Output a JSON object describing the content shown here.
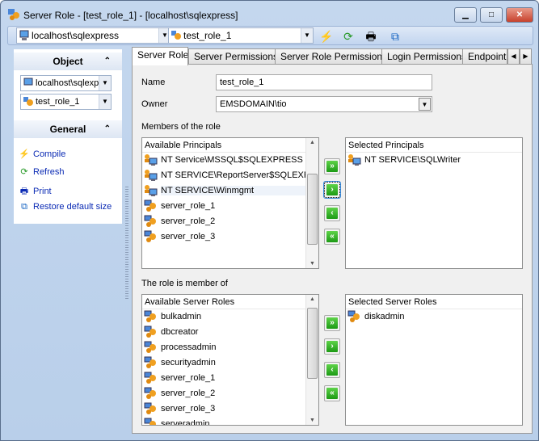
{
  "window": {
    "title": "Server Role - [test_role_1] - [localhost\\sqlexpress]",
    "minimize": "▁",
    "maximize": "□",
    "close": "✕"
  },
  "toolbar": {
    "server": "localhost\\sqlexpress",
    "role": "test_role_1"
  },
  "left_panel": {
    "object_header": "Object",
    "server": "localhost\\sqlexpress",
    "role": "test_role_1",
    "general_header": "General",
    "items": [
      {
        "label": "Compile",
        "icon": "compile-icon"
      },
      {
        "label": "Refresh",
        "icon": "refresh-icon"
      },
      {
        "label": "Print",
        "icon": "print-icon"
      },
      {
        "label": "Restore default size",
        "icon": "restore-size-icon"
      }
    ]
  },
  "tabs": [
    "Server Role",
    "Server Permissions",
    "Server Role Permissions",
    "Login Permissions",
    "Endpoint P"
  ],
  "form": {
    "name_label": "Name",
    "name_value": "test_role_1",
    "owner_label": "Owner",
    "owner_value": "EMSDOMAIN\\tio"
  },
  "members": {
    "section_label": "Members of the role",
    "available_header": "Available Principals",
    "available": [
      {
        "text": "NT Service\\MSSQL$SQLEXPRESS",
        "type": "login"
      },
      {
        "text": "NT SERVICE\\ReportServer$SQLEXPRESS",
        "type": "login"
      },
      {
        "text": "NT SERVICE\\Winmgmt",
        "type": "login",
        "selected": true
      },
      {
        "text": "server_role_1",
        "type": "role"
      },
      {
        "text": "server_role_2",
        "type": "role"
      },
      {
        "text": "server_role_3",
        "type": "role"
      }
    ],
    "selected_header": "Selected Principals",
    "selected": [
      {
        "text": "NT SERVICE\\SQLWriter",
        "type": "login"
      }
    ]
  },
  "member_of": {
    "section_label": "The role is member of",
    "available_header": "Available Server Roles",
    "available": [
      "bulkadmin",
      "dbcreator",
      "processadmin",
      "securityadmin",
      "server_role_1",
      "server_role_2",
      "server_role_3",
      "serveradmin"
    ],
    "selected_header": "Selected Server Roles",
    "selected": [
      "diskadmin"
    ]
  },
  "buttons": {
    "add_all": "»",
    "add": "›",
    "remove": "‹",
    "remove_all": "«"
  }
}
